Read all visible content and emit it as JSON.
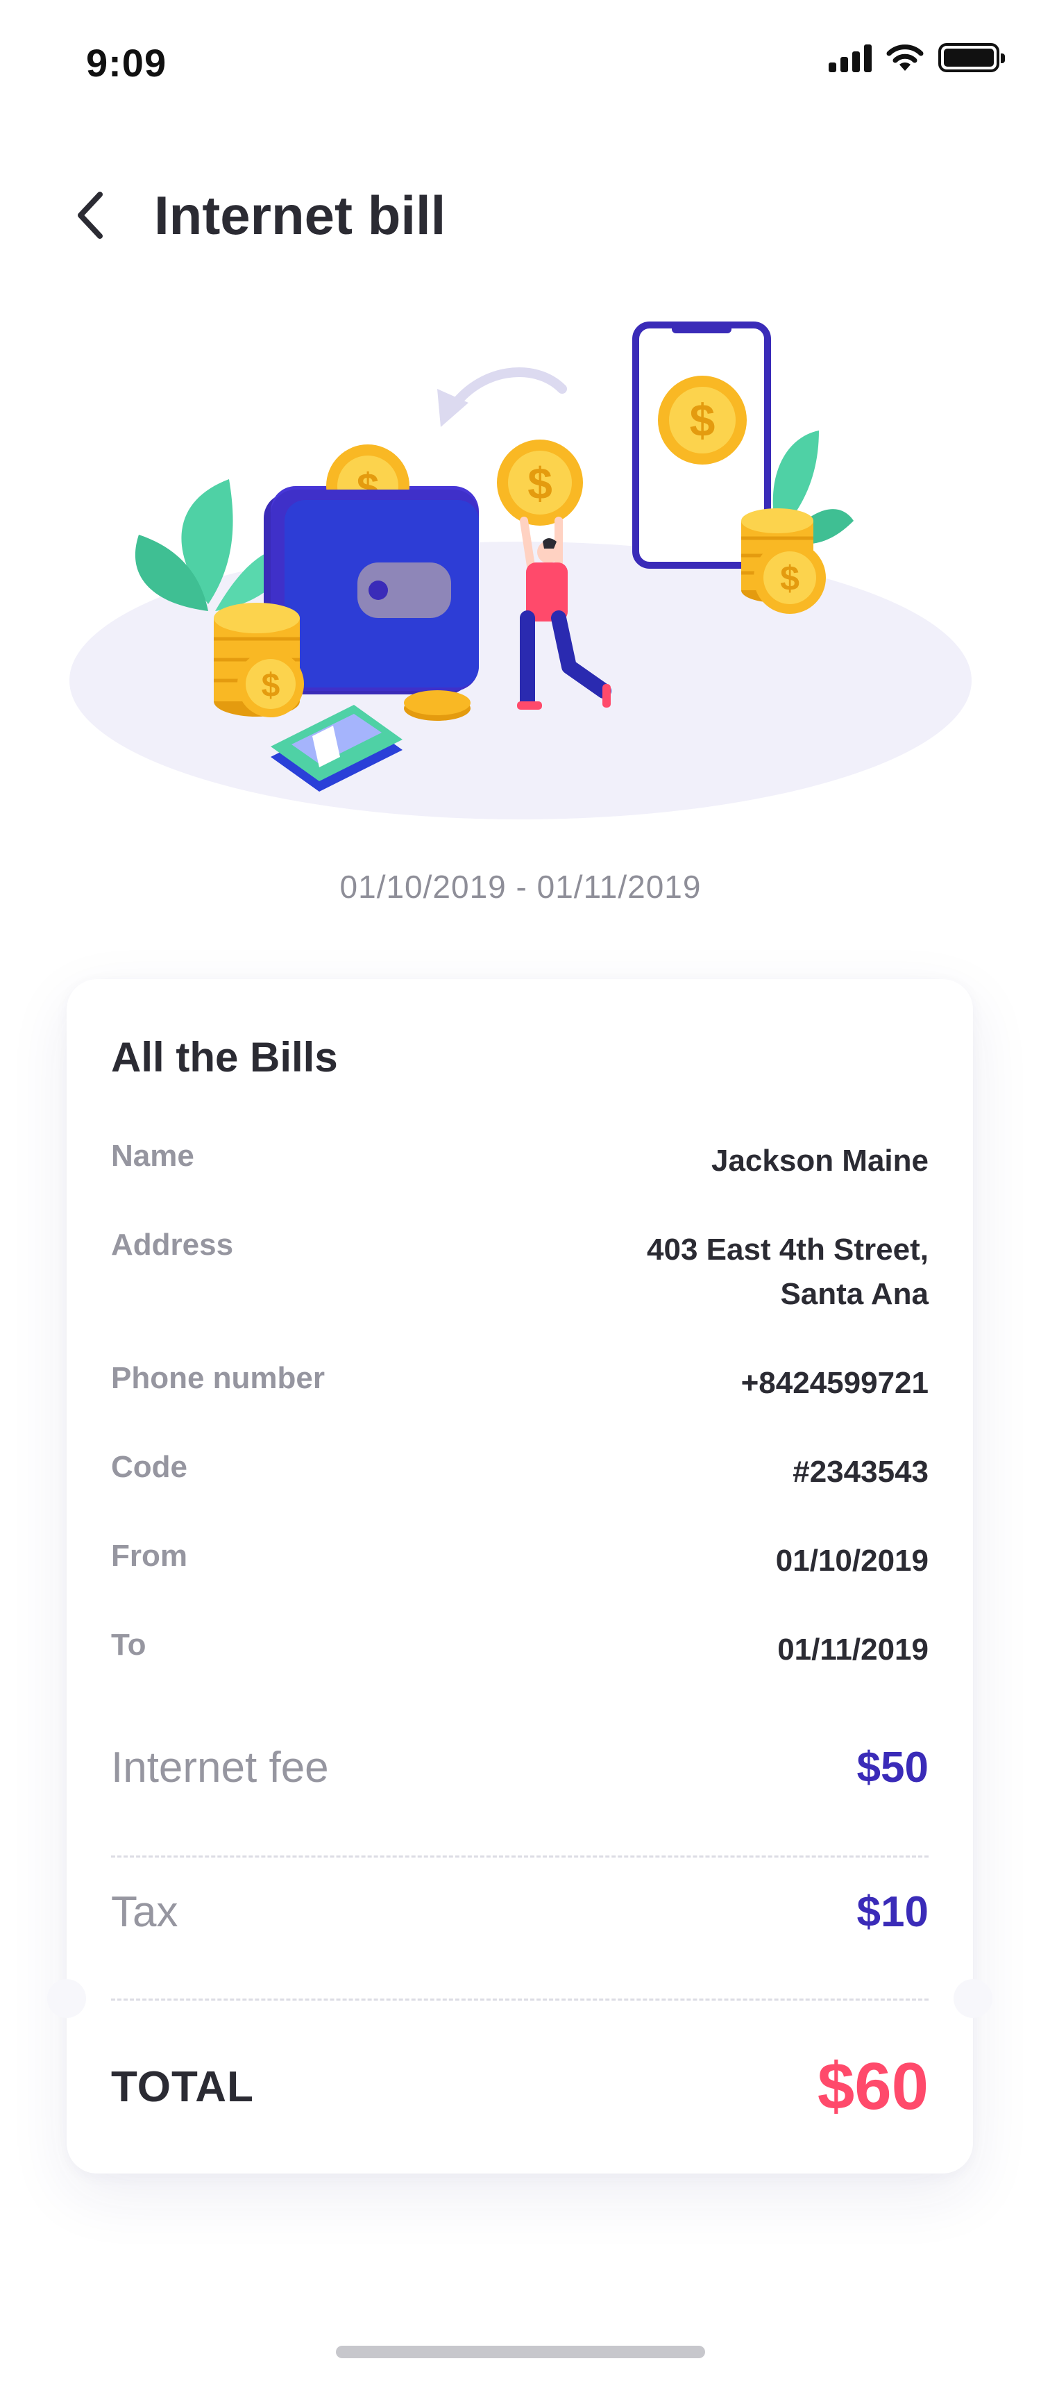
{
  "status_bar": {
    "time": "9:09"
  },
  "header": {
    "title": "Internet bill"
  },
  "date_range": "01/10/2019 - 01/11/2019",
  "bills": {
    "title": "All the Bills",
    "name": {
      "label": "Name",
      "value": "Jackson Maine"
    },
    "address": {
      "label": "Address",
      "value_line1": "403 East 4th Street,",
      "value_line2": "Santa Ana"
    },
    "phone": {
      "label": "Phone number",
      "value": "+8424599721"
    },
    "code": {
      "label": "Code",
      "value": "#2343543"
    },
    "from": {
      "label": "From",
      "value": "01/10/2019"
    },
    "to": {
      "label": "To",
      "value": "01/11/2019"
    },
    "internet_fee": {
      "label": "Internet fee",
      "value": "$50"
    },
    "tax": {
      "label": "Tax",
      "value": "$10"
    },
    "total": {
      "label": "TOTAL",
      "value": "$60"
    }
  },
  "colors": {
    "accent": "#3a2bb8",
    "total": "#ff4a6b",
    "coin": "#f9b824",
    "wallet": "#3a2bb8",
    "leaf": "#4fd1a5"
  },
  "icons": {
    "back": "chevron-left-icon",
    "signal": "signal-icon",
    "wifi": "wifi-icon",
    "battery": "battery-icon"
  }
}
